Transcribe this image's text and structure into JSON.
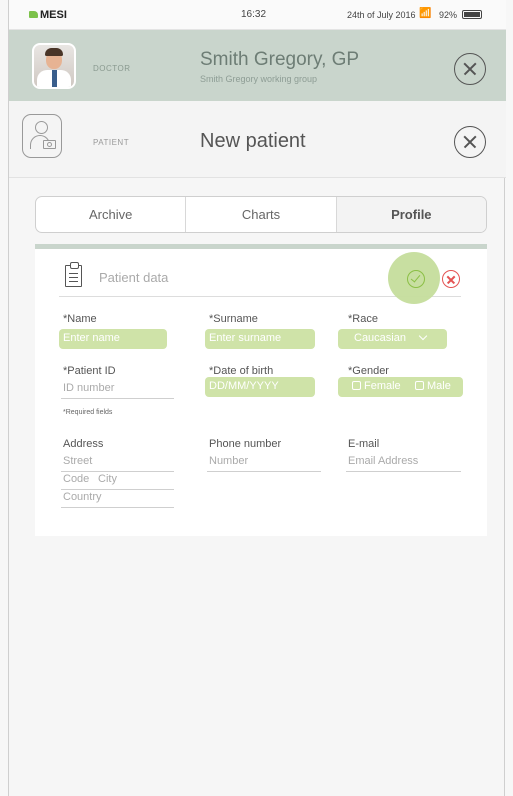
{
  "status_bar": {
    "brand": "MESI",
    "time": "16:32",
    "date": "24th of July 2016",
    "battery": "92%"
  },
  "doctor": {
    "role": "DOCTOR",
    "name": "Smith Gregory, GP",
    "group": "Smith Gregory working group"
  },
  "patient": {
    "role": "PATIENT",
    "name": "New patient"
  },
  "tabs": [
    {
      "label": "Archive"
    },
    {
      "label": "Charts"
    },
    {
      "label": "Profile",
      "active": true
    }
  ],
  "form": {
    "title": "Patient data",
    "name_label": "*Name",
    "name_placeholder": "Enter name",
    "surname_label": "*Surname",
    "surname_placeholder": "Enter surname",
    "race_label": "*Race",
    "race_value": "Caucasian",
    "patient_id_label": "*Patient ID",
    "patient_id_placeholder": "ID number",
    "dob_label": "*Date of birth",
    "dob_placeholder": "DD/MM/YYYY",
    "gender_label": "*Gender",
    "gender_female": "Female",
    "gender_male": "Male",
    "required_note": "*Required fields",
    "address_label": "Address",
    "street_placeholder": "Street",
    "code_placeholder": "Code",
    "city_placeholder": "City",
    "country_placeholder": "Country",
    "phone_label": "Phone number",
    "phone_placeholder": "Number",
    "email_label": "E-mail",
    "email_placeholder": "Email Address"
  },
  "colors": {
    "header_green": "#c9d5cc",
    "highlight_green": "#cfe3a8",
    "confirm_green": "#8bbf45",
    "cancel_red": "#e45353"
  }
}
